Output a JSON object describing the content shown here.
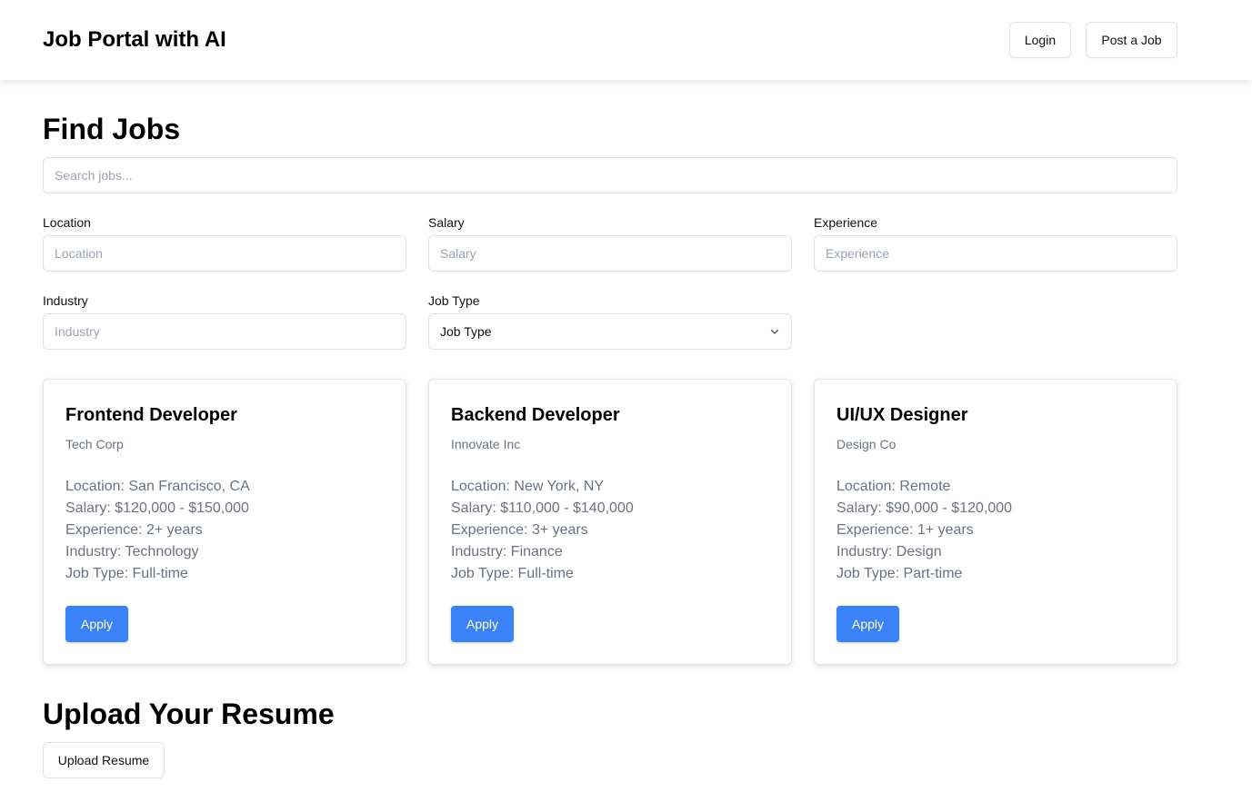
{
  "header": {
    "title": "Job Portal with AI",
    "login_label": "Login",
    "post_job_label": "Post a Job"
  },
  "search": {
    "heading": "Find Jobs",
    "placeholder": "Search jobs...",
    "value": ""
  },
  "filters": {
    "location": {
      "label": "Location",
      "placeholder": "Location",
      "value": ""
    },
    "salary": {
      "label": "Salary",
      "placeholder": "Salary",
      "value": ""
    },
    "experience": {
      "label": "Experience",
      "placeholder": "Experience",
      "value": ""
    },
    "industry": {
      "label": "Industry",
      "placeholder": "Industry",
      "value": ""
    },
    "job_type": {
      "label": "Job Type",
      "selected": "Job Type"
    }
  },
  "jobs": [
    {
      "title": "Frontend Developer",
      "company": "Tech Corp",
      "location": "Location: San Francisco, CA",
      "salary": "Salary: $120,000 - $150,000",
      "experience": "Experience: 2+ years",
      "industry": "Industry: Technology",
      "job_type": "Job Type: Full-time",
      "apply_label": "Apply"
    },
    {
      "title": "Backend Developer",
      "company": "Innovate Inc",
      "location": "Location: New York, NY",
      "salary": "Salary: $110,000 - $140,000",
      "experience": "Experience: 3+ years",
      "industry": "Industry: Finance",
      "job_type": "Job Type: Full-time",
      "apply_label": "Apply"
    },
    {
      "title": "UI/UX Designer",
      "company": "Design Co",
      "location": "Location: Remote",
      "salary": "Salary: $90,000 - $120,000",
      "experience": "Experience: 1+ years",
      "industry": "Industry: Design",
      "job_type": "Job Type: Part-time",
      "apply_label": "Apply"
    }
  ],
  "resume": {
    "heading": "Upload Your Resume",
    "button_label": "Upload Resume"
  },
  "colors": {
    "accent": "#3b82f6",
    "muted_text": "#6b7280",
    "border": "#e0e0e0"
  },
  "icons": {
    "select_arrow": "chevron-down-icon"
  }
}
